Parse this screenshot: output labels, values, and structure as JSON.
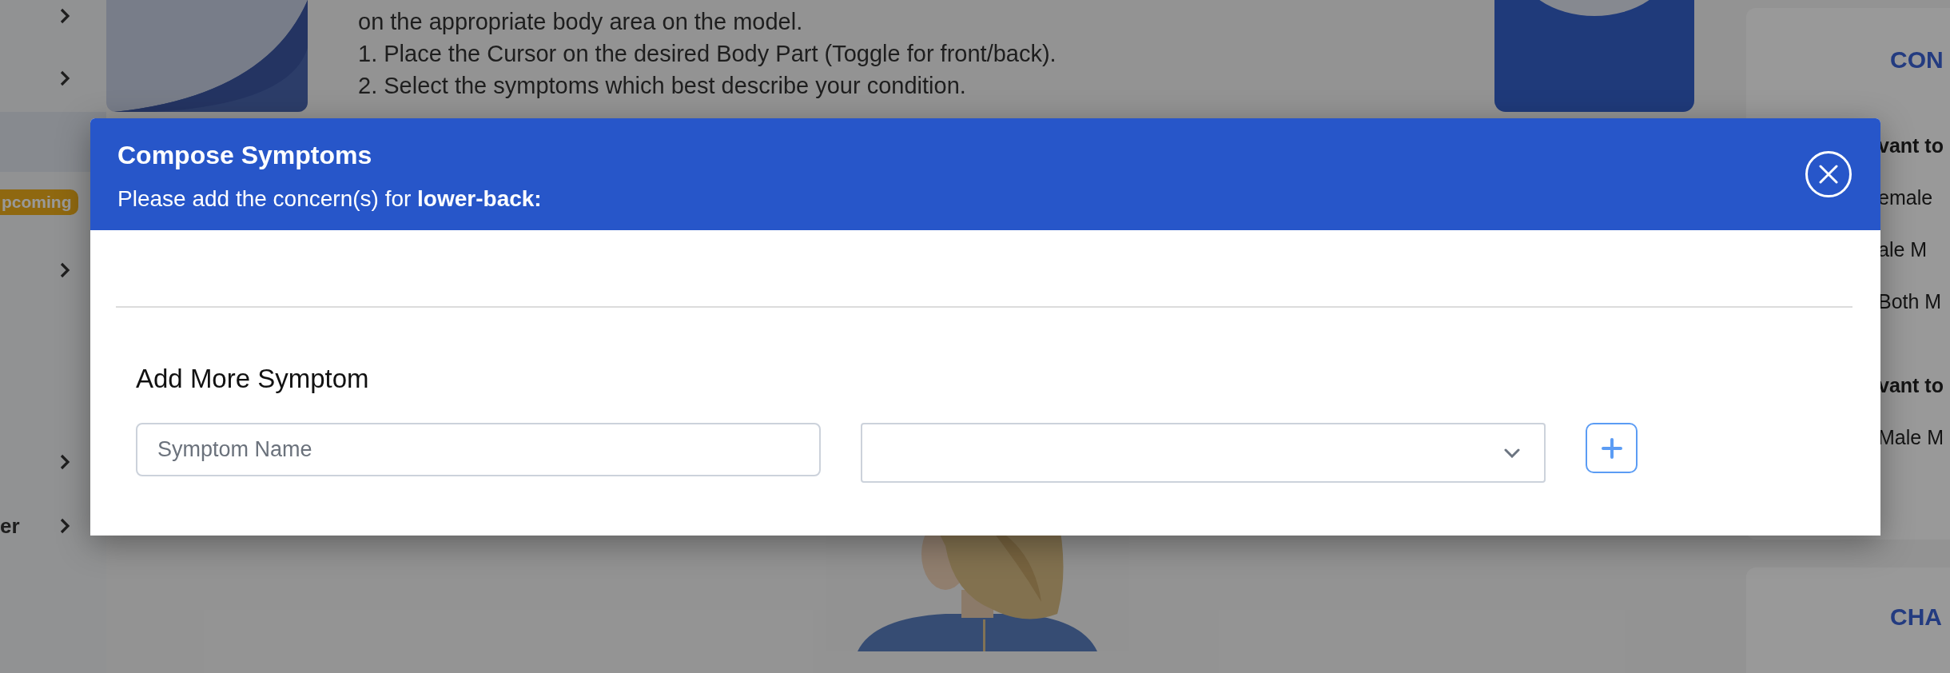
{
  "sidebar": {
    "items": [
      {
        "kind": "link"
      },
      {
        "kind": "link"
      },
      {
        "kind": "badge",
        "label": "pcoming"
      },
      {
        "kind": "link"
      },
      {
        "kind": "link"
      },
      {
        "kind": "link",
        "label": "er"
      }
    ]
  },
  "instructions": [
    "on the appropriate body area on the model.",
    "1. Place the Cursor on the desired Body Part (Toggle for front/back).",
    "2. Select the symptoms which best describe your condition."
  ],
  "right_panel": {
    "cards": [
      {
        "heading": "CON",
        "lines": [
          {
            "kind": "question",
            "text": "vant to"
          },
          {
            "kind": "option",
            "text": "emale"
          },
          {
            "kind": "option",
            "text": "ale M"
          },
          {
            "kind": "option",
            "text": "Both M"
          },
          {
            "kind": "question",
            "text": "vant to"
          },
          {
            "kind": "option",
            "text": "Male M"
          }
        ]
      },
      {
        "heading": "CHA"
      }
    ]
  },
  "modal": {
    "title": "Compose Symptoms",
    "subtitle": "Please add the concern(s) for **lower-back:**",
    "section_title": "Add More Symptom",
    "symptom_field": {
      "placeholder": "Symptom Name"
    }
  }
}
